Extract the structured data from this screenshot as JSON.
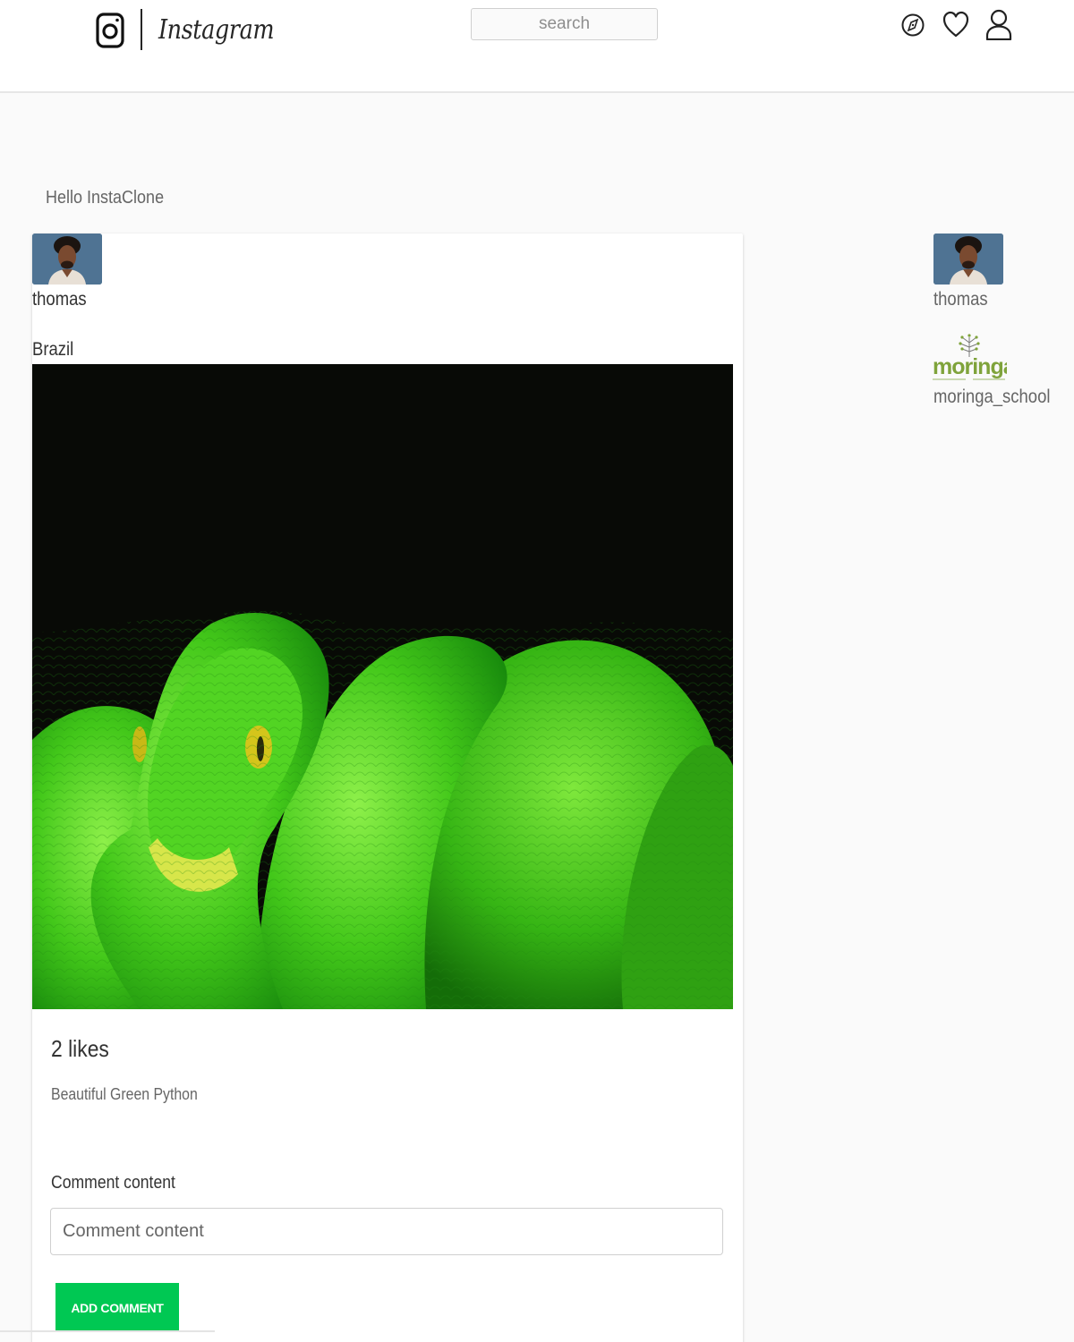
{
  "navbar": {
    "brand": "Instagram",
    "search": {
      "placeholder": "search",
      "value": ""
    },
    "icons": [
      "compass-icon",
      "heart-icon",
      "profile-icon"
    ]
  },
  "greeting": "Hello InstaClone",
  "post": {
    "username": "thomas",
    "location": "Brazil",
    "likes": "2 likes",
    "caption": "Beautiful Green Python",
    "comment_label": "Comment content",
    "comment_placeholder": "Comment content",
    "add_comment": "ADD COMMENT"
  },
  "sidebar": {
    "users": [
      {
        "username": "thomas"
      },
      {
        "username": "moringa_school",
        "logo_text": "moringa"
      }
    ]
  },
  "colors": {
    "accent_green": "#00c853",
    "avatar_bg": "#4f7393",
    "logo_green": "#7fa33b"
  }
}
